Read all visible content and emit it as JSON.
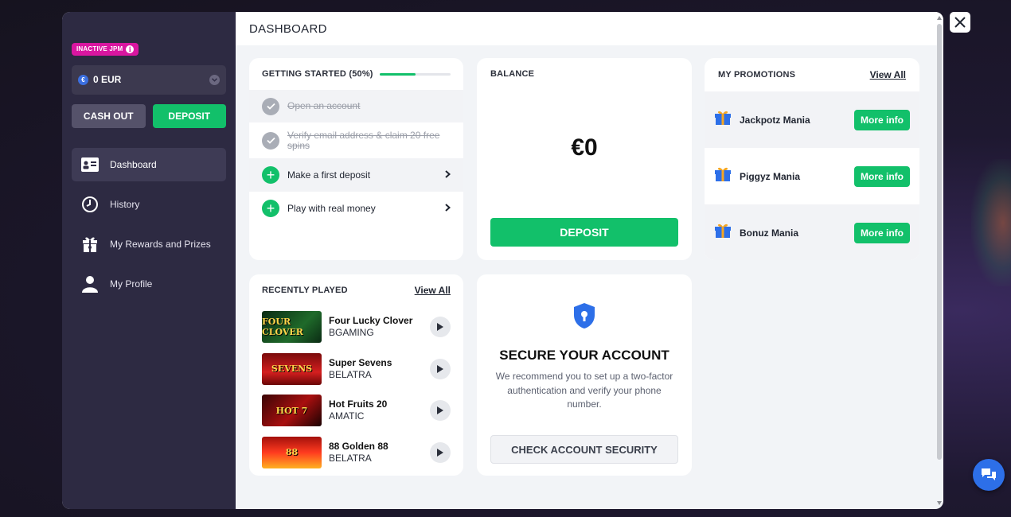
{
  "sidebar": {
    "jpm_badge": "INACTIVE JPM",
    "balance_select": {
      "amount": "0 EUR"
    },
    "cash_out_label": "CASH OUT",
    "deposit_label": "DEPOSIT",
    "nav": [
      {
        "label": "Dashboard",
        "icon": "dashboard-card-icon",
        "active": true
      },
      {
        "label": "History",
        "icon": "clock-icon"
      },
      {
        "label": "My Rewards and Prizes",
        "icon": "gift-box-icon"
      },
      {
        "label": "My Profile",
        "icon": "user-icon"
      }
    ]
  },
  "header": {
    "title": "DASHBOARD"
  },
  "getting_started": {
    "title": "GETTING STARTED (50%)",
    "progress": 0.5,
    "steps": [
      {
        "label": "Open an account",
        "done": true
      },
      {
        "label": "Verify email address & claim 20 free spins",
        "done": true
      },
      {
        "label": "Make a first deposit",
        "done": false
      },
      {
        "label": "Play with real money",
        "done": false
      }
    ]
  },
  "balance": {
    "title": "BALANCE",
    "amount": "€0",
    "deposit_label": "DEPOSIT"
  },
  "promotions": {
    "title": "MY PROMOTIONS",
    "view_all": "View All",
    "items": [
      {
        "name": "Jackpotz Mania",
        "button": "More info"
      },
      {
        "name": "Piggyz Mania",
        "button": "More info"
      },
      {
        "name": "Bonuz Mania",
        "button": "More info"
      }
    ]
  },
  "recently_played": {
    "title": "RECENTLY PLAYED",
    "view_all": "View All",
    "games": [
      {
        "title": "Four Lucky Clover",
        "provider": "BGAMING",
        "thumb_text": "FOUR CLOVER"
      },
      {
        "title": "Super Sevens",
        "provider": "BELATRA",
        "thumb_text": "SEVENS"
      },
      {
        "title": "Hot Fruits 20",
        "provider": "AMATIC",
        "thumb_text": "HOT 7"
      },
      {
        "title": "88 Golden 88",
        "provider": "BELATRA",
        "thumb_text": "88"
      }
    ]
  },
  "security": {
    "title": "SECURE YOUR ACCOUNT",
    "text": "We recommend you to set up a two-factor authentication and verify your phone number.",
    "button": "CHECK ACCOUNT SECURITY"
  },
  "colors": {
    "accent_green": "#12c06a",
    "sidebar_bg": "#2d2a42",
    "badge_pink": "#d916a0",
    "chat_blue": "#2d6fe8"
  }
}
